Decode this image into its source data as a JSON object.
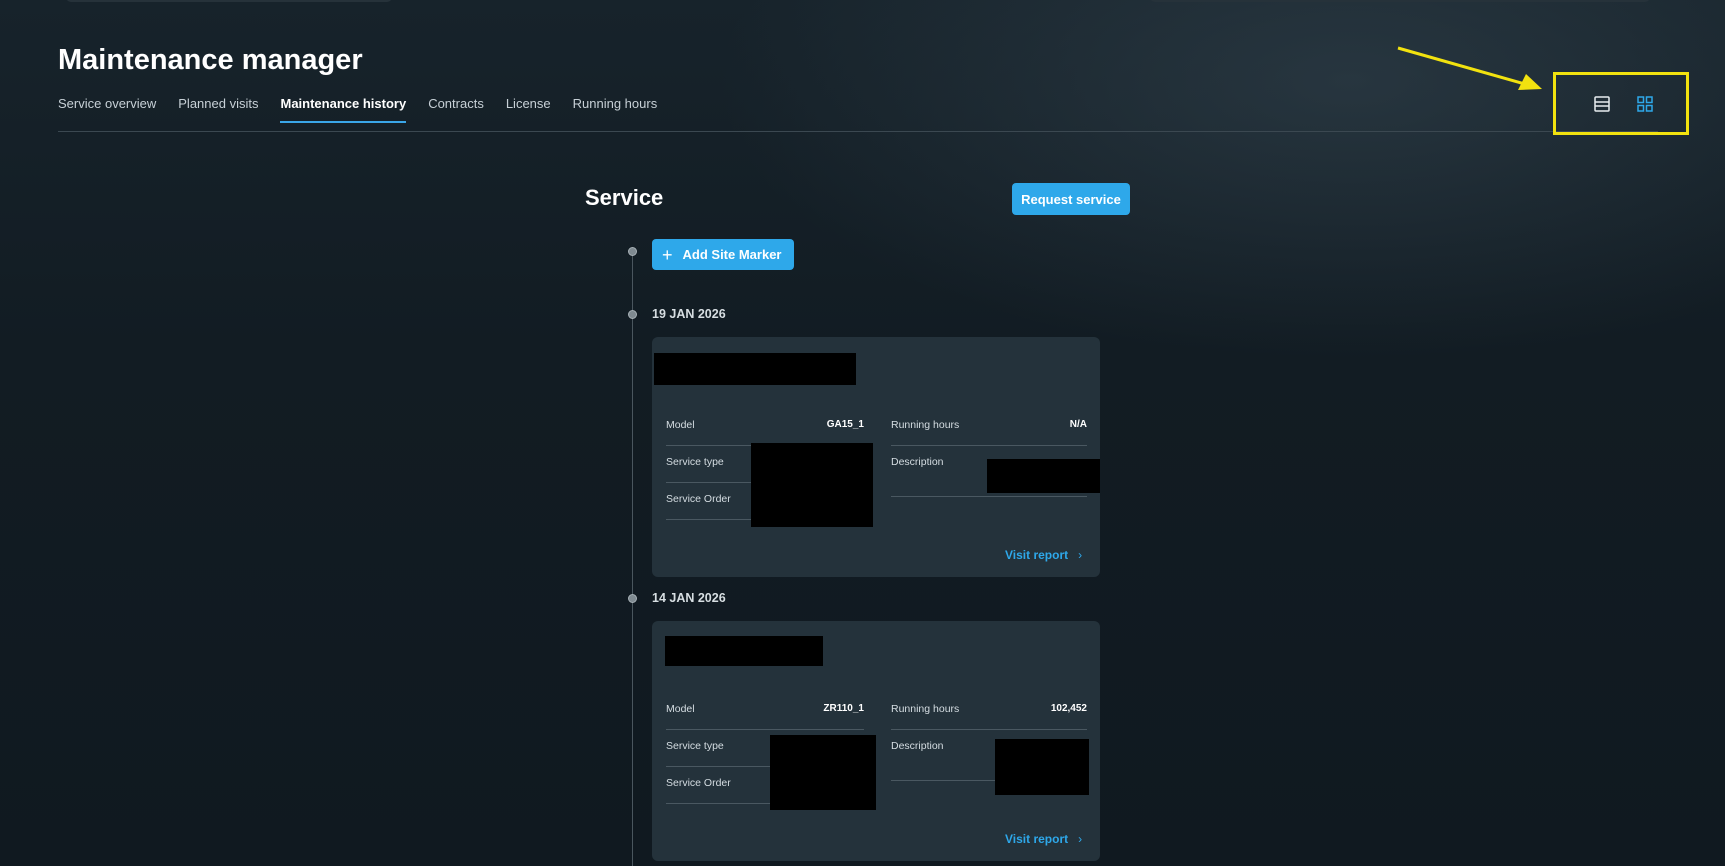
{
  "page": {
    "title": "Maintenance manager",
    "tabs": [
      {
        "label": "Service overview",
        "active": false
      },
      {
        "label": "Planned visits",
        "active": false
      },
      {
        "label": "Maintenance history",
        "active": true
      },
      {
        "label": "Contracts",
        "active": false
      },
      {
        "label": "License",
        "active": false
      },
      {
        "label": "Running hours",
        "active": false
      }
    ],
    "view_toggle": {
      "list_icon": "list-view-icon",
      "grid_icon": "grid-view-icon",
      "highlight_color": "#f2e20f"
    }
  },
  "service": {
    "heading": "Service",
    "request_button": "Request service",
    "add_marker_label": "Add Site Marker",
    "add_marker_icon": "plus-icon"
  },
  "entries": [
    {
      "date": "19 JAN 2026",
      "fields": {
        "model_label": "Model",
        "model_value": "GA15_1",
        "service_type_label": "Service type",
        "service_order_label": "Service Order",
        "running_hours_label": "Running hours",
        "running_hours_value": "N/A",
        "description_label": "Description"
      },
      "visit_label": "Visit report"
    },
    {
      "date": "14 JAN 2026",
      "fields": {
        "model_label": "Model",
        "model_value": "ZR110_1",
        "service_type_label": "Service type",
        "service_order_label": "Service Order",
        "running_hours_label": "Running hours",
        "running_hours_value": "102,452",
        "description_label": "Description"
      },
      "visit_label": "Visit report"
    }
  ],
  "colors": {
    "accent": "#2ea8ea",
    "background": "#111b22",
    "card": "#24323b"
  }
}
